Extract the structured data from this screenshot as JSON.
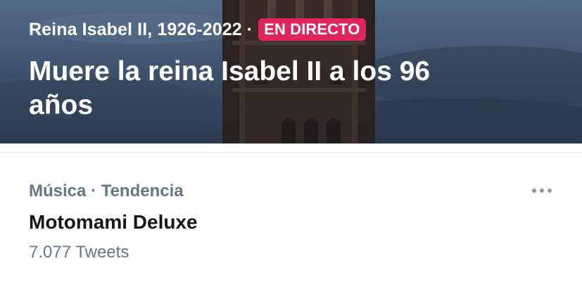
{
  "hero": {
    "topic": "Reina Isabel II, 1926-2022",
    "separator": "·",
    "live_badge": "EN DIRECTO",
    "headline": "Muere la reina Isabel II a los 96 años"
  },
  "trend": {
    "category": "Música · Tendencia",
    "title": "Motomami Deluxe",
    "count": "7.077 Tweets",
    "more_icon": "more-horizontal-icon"
  },
  "colors": {
    "live_badge": "#e0245e",
    "secondary_text": "#657786",
    "primary_text": "#14171a",
    "divider": "#e1e8ed"
  }
}
